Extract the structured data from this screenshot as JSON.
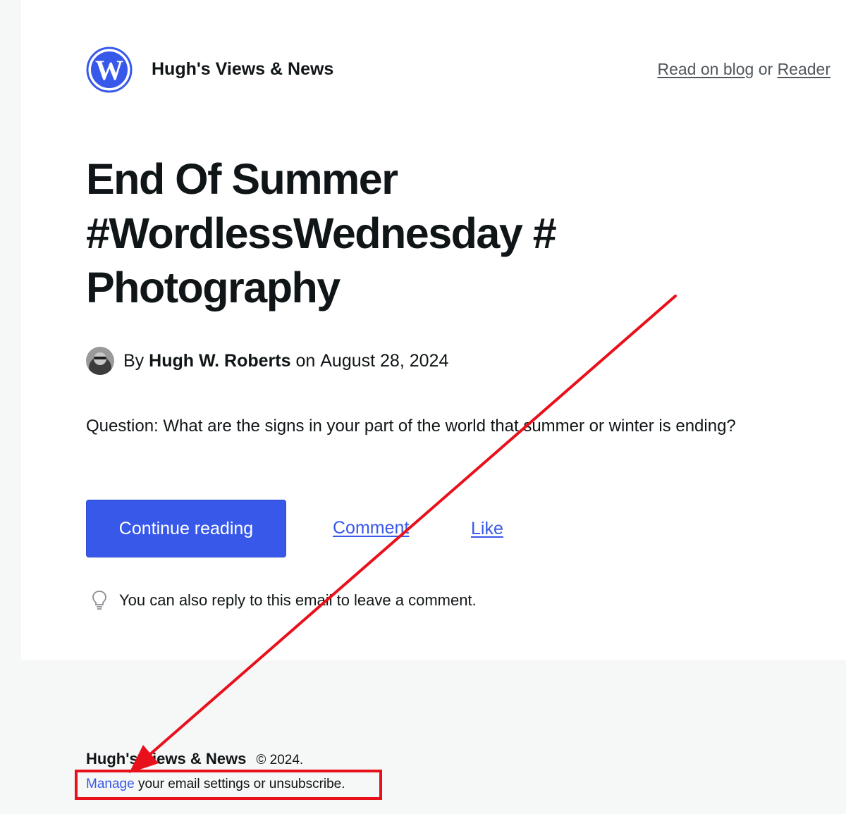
{
  "header": {
    "site_name": "Hugh's Views & News",
    "read_on_blog": "Read on blog",
    "or": "or",
    "reader": "Reader"
  },
  "post": {
    "title": "End Of Summer #WordlessWednesday # Photography",
    "by": "By",
    "author": "Hugh W. Roberts",
    "on": "on",
    "date": "August 28, 2024",
    "excerpt": "Question: What are the signs in your part of the world that summer or winter is ending?"
  },
  "actions": {
    "continue_reading": "Continue reading",
    "comment": "Comment",
    "like": "Like"
  },
  "tip": {
    "text": "You can also reply to this email to leave a comment."
  },
  "footer": {
    "site_name": "Hugh's Views & News",
    "copyright": "© 2024.",
    "manage": "Manage",
    "manage_rest": " your email settings or unsubscribe."
  },
  "colors": {
    "accent": "#3858e9",
    "annotation": "#e8101b",
    "background": "#f6f7f7",
    "card": "#ffffff"
  },
  "icons": {
    "logo": "wordpress-logo-icon",
    "tip": "lightbulb-icon"
  }
}
